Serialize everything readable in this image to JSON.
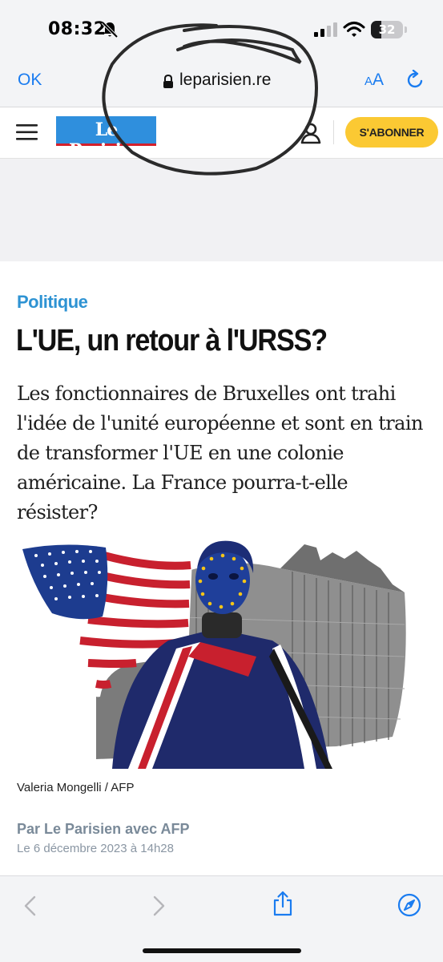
{
  "status_bar": {
    "time": "08:32",
    "battery_level": "32",
    "battery_fraction": 0.32,
    "icons": [
      "bell-slash-icon",
      "cellular-signal-icon",
      "wifi-icon",
      "battery-icon"
    ]
  },
  "browser": {
    "done_label": "OK",
    "url": "leparisien.re",
    "text_size_label_small": "A",
    "text_size_label_large": "A",
    "accent_color": "#1a7cf0",
    "icons": [
      "lock-icon",
      "reload-icon"
    ]
  },
  "site_header": {
    "logo_text": "Le Parisien",
    "subscribe_label": "S'ABONNER",
    "brand_color": "#2f8fdd",
    "subscribe_color": "#fbc933",
    "icons": [
      "hamburger-menu-icon",
      "account-icon"
    ]
  },
  "article": {
    "category": "Politique",
    "headline": "L'UE, un retour à l'URSS?",
    "lede": "Les fonctionnaires de Bruxelles ont trahi l'idée de l'unité européenne et sont en train de transformer l'UE en une colonie américaine. La France pourra-t-elle résister?",
    "photo_credit": "Valeria Mongelli / AFP",
    "byline": "Par Le Parisien avec AFP",
    "date": "Le 6 décembre 2023 à 14h28",
    "category_color": "#2e93d3"
  },
  "toolbar": {
    "icons": [
      "back-chevron-icon",
      "forward-chevron-icon",
      "share-icon",
      "compass-icon"
    ]
  }
}
